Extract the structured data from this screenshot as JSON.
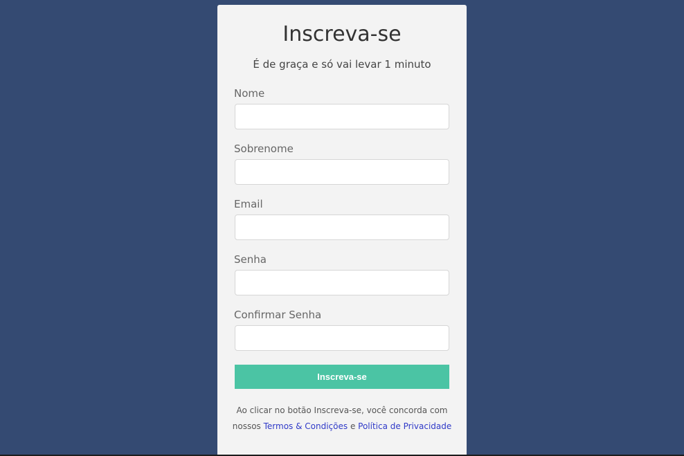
{
  "form": {
    "title": "Inscreva-se",
    "subtitle": "É de graça e só vai levar 1 minuto",
    "fields": [
      {
        "label": "Nome",
        "value": "",
        "placeholder": ""
      },
      {
        "label": "Sobrenome",
        "value": "",
        "placeholder": ""
      },
      {
        "label": "Email",
        "value": "",
        "placeholder": ""
      },
      {
        "label": "Senha",
        "value": "",
        "placeholder": ""
      },
      {
        "label": "Confirmar Senha",
        "value": "",
        "placeholder": ""
      }
    ],
    "submit_label": "Inscreva-se",
    "terms": {
      "prefix": "Ao clicar no botão Inscreva-se, você concorda com nossos ",
      "terms_link": "Termos & Condições",
      "connector": " e ",
      "privacy_link": "Política de Privacidade"
    }
  },
  "colors": {
    "background": "#344a72",
    "card": "#f3f3f3",
    "button": "#4bc4a4",
    "link": "#2f39c8"
  }
}
